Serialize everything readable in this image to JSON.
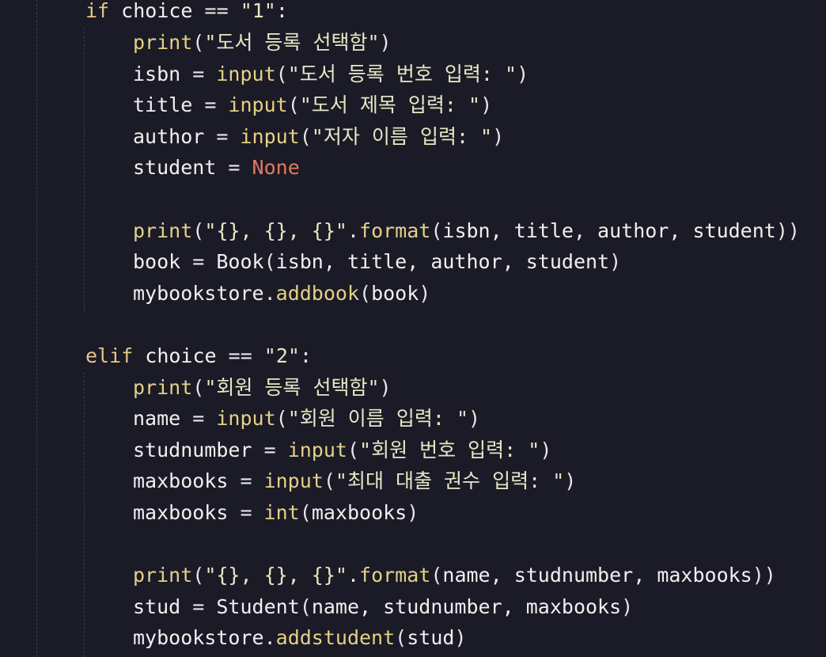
{
  "editor": {
    "language": "python",
    "colors": {
      "background": "#1a1b26",
      "keyword": "#e7c787",
      "function": "#e6d088",
      "string": "#e8e6c6",
      "constant": "#e27a5f",
      "text": "#f0f0f0"
    },
    "lines": [
      {
        "id": "l1",
        "tokens": [
          [
            "kw",
            "if"
          ],
          [
            "var",
            " choice "
          ],
          [
            "op",
            "=="
          ],
          [
            "str",
            " \"1\""
          ],
          [
            "punc",
            ":"
          ]
        ]
      },
      {
        "id": "l2",
        "tokens": [
          [
            "fn",
            "print"
          ],
          [
            "punc",
            "("
          ],
          [
            "str",
            "\"도서 등록 선택함\""
          ],
          [
            "punc",
            ")"
          ]
        ]
      },
      {
        "id": "l3",
        "tokens": [
          [
            "var",
            "isbn "
          ],
          [
            "op",
            "="
          ],
          [
            "fn",
            " input"
          ],
          [
            "punc",
            "("
          ],
          [
            "str",
            "\"도서 등록 번호 입력: \""
          ],
          [
            "punc",
            ")"
          ]
        ]
      },
      {
        "id": "l4",
        "tokens": [
          [
            "var",
            "title "
          ],
          [
            "op",
            "="
          ],
          [
            "fn",
            " input"
          ],
          [
            "punc",
            "("
          ],
          [
            "str",
            "\"도서 제목 입력: \""
          ],
          [
            "punc",
            ")"
          ]
        ]
      },
      {
        "id": "l5",
        "tokens": [
          [
            "var",
            "author "
          ],
          [
            "op",
            "="
          ],
          [
            "fn",
            " input"
          ],
          [
            "punc",
            "("
          ],
          [
            "str",
            "\"저자 이름 입력: \""
          ],
          [
            "punc",
            ")"
          ]
        ]
      },
      {
        "id": "l6",
        "tokens": [
          [
            "var",
            "student "
          ],
          [
            "op",
            "="
          ],
          [
            "const",
            " None"
          ]
        ]
      },
      {
        "id": "l7",
        "tokens": []
      },
      {
        "id": "l8",
        "tokens": [
          [
            "fn",
            "print"
          ],
          [
            "punc",
            "("
          ],
          [
            "str",
            "\"{}, {}, {}\""
          ],
          [
            "punc",
            "."
          ],
          [
            "fn",
            "format"
          ],
          [
            "punc",
            "("
          ],
          [
            "var",
            "isbn, title, author, student"
          ],
          [
            "punc",
            "))"
          ]
        ]
      },
      {
        "id": "l9",
        "tokens": [
          [
            "var",
            "book "
          ],
          [
            "op",
            "="
          ],
          [
            "var",
            " Book"
          ],
          [
            "punc",
            "("
          ],
          [
            "var",
            "isbn, title, author, student"
          ],
          [
            "punc",
            ")"
          ]
        ]
      },
      {
        "id": "l10",
        "tokens": [
          [
            "var",
            "mybookstore"
          ],
          [
            "punc",
            "."
          ],
          [
            "fn",
            "addbook"
          ],
          [
            "punc",
            "("
          ],
          [
            "var",
            "book"
          ],
          [
            "punc",
            ")"
          ]
        ]
      },
      {
        "id": "l11",
        "tokens": []
      },
      {
        "id": "l12",
        "tokens": [
          [
            "kw",
            "elif"
          ],
          [
            "var",
            " choice "
          ],
          [
            "op",
            "=="
          ],
          [
            "str",
            " \"2\""
          ],
          [
            "punc",
            ":"
          ]
        ]
      },
      {
        "id": "l13",
        "tokens": [
          [
            "fn",
            "print"
          ],
          [
            "punc",
            "("
          ],
          [
            "str",
            "\"회원 등록 선택함\""
          ],
          [
            "punc",
            ")"
          ]
        ]
      },
      {
        "id": "l14",
        "tokens": [
          [
            "var",
            "name "
          ],
          [
            "op",
            "="
          ],
          [
            "fn",
            " input"
          ],
          [
            "punc",
            "("
          ],
          [
            "str",
            "\"회원 이름 입력: \""
          ],
          [
            "punc",
            ")"
          ]
        ]
      },
      {
        "id": "l15",
        "tokens": [
          [
            "var",
            "studnumber "
          ],
          [
            "op",
            "="
          ],
          [
            "fn",
            " input"
          ],
          [
            "punc",
            "("
          ],
          [
            "str",
            "\"회원 번호 입력: \""
          ],
          [
            "punc",
            ")"
          ]
        ]
      },
      {
        "id": "l16",
        "tokens": [
          [
            "var",
            "maxbooks "
          ],
          [
            "op",
            "="
          ],
          [
            "fn",
            " input"
          ],
          [
            "punc",
            "("
          ],
          [
            "str",
            "\"최대 대출 권수 입력: \""
          ],
          [
            "punc",
            ")"
          ]
        ]
      },
      {
        "id": "l17",
        "tokens": [
          [
            "var",
            "maxbooks "
          ],
          [
            "op",
            "="
          ],
          [
            "fn",
            " int"
          ],
          [
            "punc",
            "("
          ],
          [
            "var",
            "maxbooks"
          ],
          [
            "punc",
            ")"
          ]
        ]
      },
      {
        "id": "l18",
        "tokens": []
      },
      {
        "id": "l19",
        "tokens": [
          [
            "fn",
            "print"
          ],
          [
            "punc",
            "("
          ],
          [
            "str",
            "\"{}, {}, {}\""
          ],
          [
            "punc",
            "."
          ],
          [
            "fn",
            "format"
          ],
          [
            "punc",
            "("
          ],
          [
            "var",
            "name, studnumber, maxbooks"
          ],
          [
            "punc",
            "))"
          ]
        ]
      },
      {
        "id": "l20",
        "tokens": [
          [
            "var",
            "stud "
          ],
          [
            "op",
            "="
          ],
          [
            "var",
            " Student"
          ],
          [
            "punc",
            "("
          ],
          [
            "var",
            "name, studnumber, maxbooks"
          ],
          [
            "punc",
            ")"
          ]
        ]
      },
      {
        "id": "l21",
        "tokens": [
          [
            "var",
            "mybookstore"
          ],
          [
            "punc",
            "."
          ],
          [
            "fn",
            "addstudent"
          ],
          [
            "punc",
            "("
          ],
          [
            "var",
            "stud"
          ],
          [
            "punc",
            ")"
          ]
        ]
      }
    ]
  }
}
